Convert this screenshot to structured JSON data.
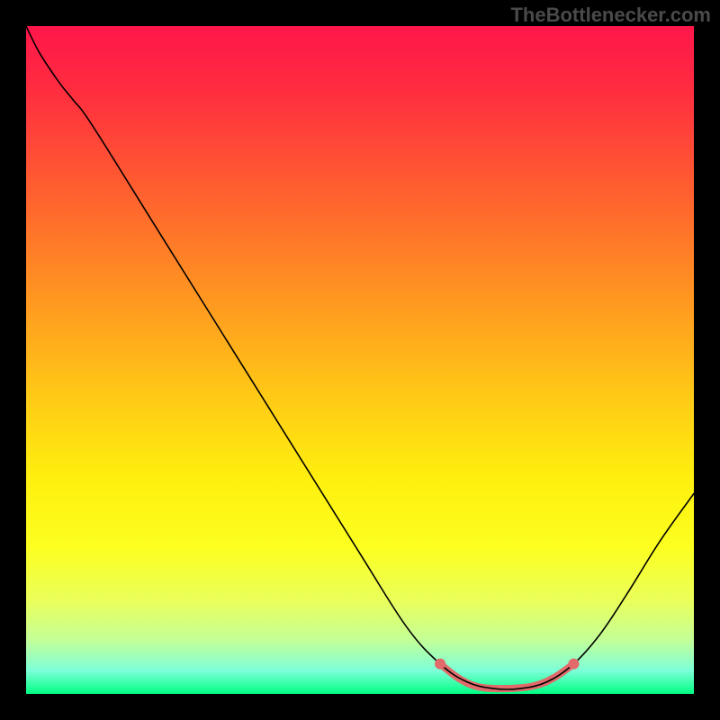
{
  "watermark": "TheBottlenecker.com",
  "chart_data": {
    "type": "line",
    "title": "",
    "xlabel": "",
    "ylabel": "",
    "xlim": [
      0,
      100
    ],
    "ylim": [
      0,
      100
    ],
    "background_gradient": {
      "stops": [
        {
          "offset": 0.0,
          "color": "#ff164a"
        },
        {
          "offset": 0.1,
          "color": "#ff2e3f"
        },
        {
          "offset": 0.25,
          "color": "#ff602f"
        },
        {
          "offset": 0.4,
          "color": "#ff9421"
        },
        {
          "offset": 0.55,
          "color": "#ffc816"
        },
        {
          "offset": 0.68,
          "color": "#fff00e"
        },
        {
          "offset": 0.78,
          "color": "#fcff20"
        },
        {
          "offset": 0.86,
          "color": "#eaff5a"
        },
        {
          "offset": 0.92,
          "color": "#c3ff98"
        },
        {
          "offset": 0.965,
          "color": "#7dffd8"
        },
        {
          "offset": 1.0,
          "color": "#00ff83"
        }
      ]
    },
    "series": [
      {
        "name": "bottleneck-curve",
        "color": "#000000",
        "width": 1.6,
        "points": [
          {
            "x": 0.0,
            "y": 100.0
          },
          {
            "x": 2.0,
            "y": 96.0
          },
          {
            "x": 5.0,
            "y": 91.5
          },
          {
            "x": 7.0,
            "y": 89.0
          },
          {
            "x": 10.0,
            "y": 85.0
          },
          {
            "x": 20.0,
            "y": 69.0
          },
          {
            "x": 30.0,
            "y": 53.0
          },
          {
            "x": 40.0,
            "y": 37.0
          },
          {
            "x": 50.0,
            "y": 21.0
          },
          {
            "x": 57.0,
            "y": 10.0
          },
          {
            "x": 62.0,
            "y": 4.5
          },
          {
            "x": 66.0,
            "y": 1.8
          },
          {
            "x": 70.0,
            "y": 0.8
          },
          {
            "x": 74.0,
            "y": 0.8
          },
          {
            "x": 78.0,
            "y": 1.8
          },
          {
            "x": 82.0,
            "y": 4.5
          },
          {
            "x": 86.0,
            "y": 9.0
          },
          {
            "x": 90.0,
            "y": 15.0
          },
          {
            "x": 95.0,
            "y": 23.0
          },
          {
            "x": 100.0,
            "y": 30.0
          }
        ]
      },
      {
        "name": "optimal-band-marker",
        "color": "#e26a6a",
        "width": 8,
        "points": [
          {
            "x": 62.0,
            "y": 4.5
          },
          {
            "x": 65.0,
            "y": 2.2
          },
          {
            "x": 68.0,
            "y": 1.0
          },
          {
            "x": 72.0,
            "y": 0.8
          },
          {
            "x": 76.0,
            "y": 1.2
          },
          {
            "x": 79.0,
            "y": 2.4
          },
          {
            "x": 82.0,
            "y": 4.5
          }
        ]
      }
    ],
    "markers": [
      {
        "name": "optimal-dot-left",
        "x": 62.0,
        "y": 4.5,
        "r": 6,
        "color": "#e26a6a"
      },
      {
        "name": "optimal-dot-right",
        "x": 82.0,
        "y": 4.5,
        "r": 6,
        "color": "#e26a6a"
      }
    ]
  }
}
